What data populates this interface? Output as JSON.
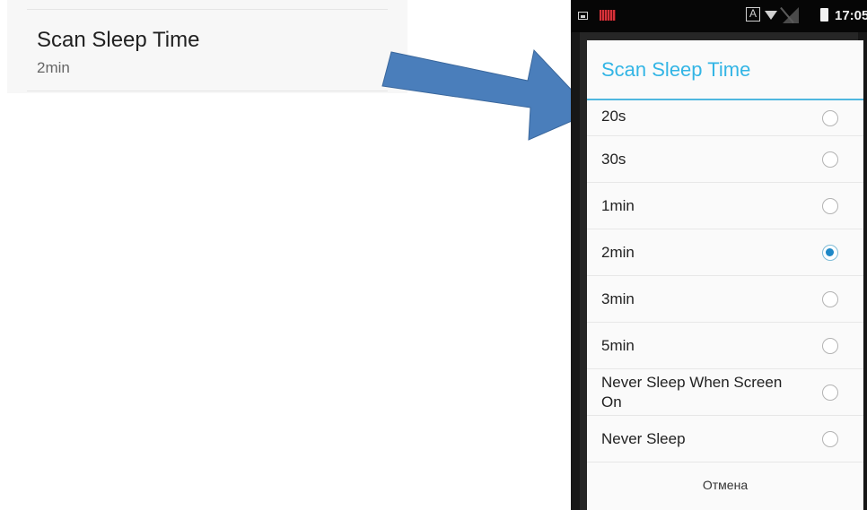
{
  "setting": {
    "title": "Scan Sleep Time",
    "value": "2min"
  },
  "status_bar": {
    "time": "17:05",
    "icons": [
      "image-icon",
      "barcode-icon",
      "auto-a-icon",
      "wifi-icon",
      "no-signal-icon",
      "battery-icon"
    ]
  },
  "dialog": {
    "title": "Scan Sleep Time",
    "options": [
      {
        "label": "20s",
        "checked": false
      },
      {
        "label": "30s",
        "checked": false
      },
      {
        "label": "1min",
        "checked": false
      },
      {
        "label": "2min",
        "checked": true
      },
      {
        "label": "3min",
        "checked": false
      },
      {
        "label": "5min",
        "checked": false
      },
      {
        "label": "Never Sleep When Screen On",
        "checked": false
      },
      {
        "label": "Never Sleep",
        "checked": false
      }
    ],
    "cancel_label": "Отмена"
  },
  "colors": {
    "accent": "#33b5e5",
    "radio_selected": "#1e88c7",
    "arrow": "#4a7ebb"
  }
}
